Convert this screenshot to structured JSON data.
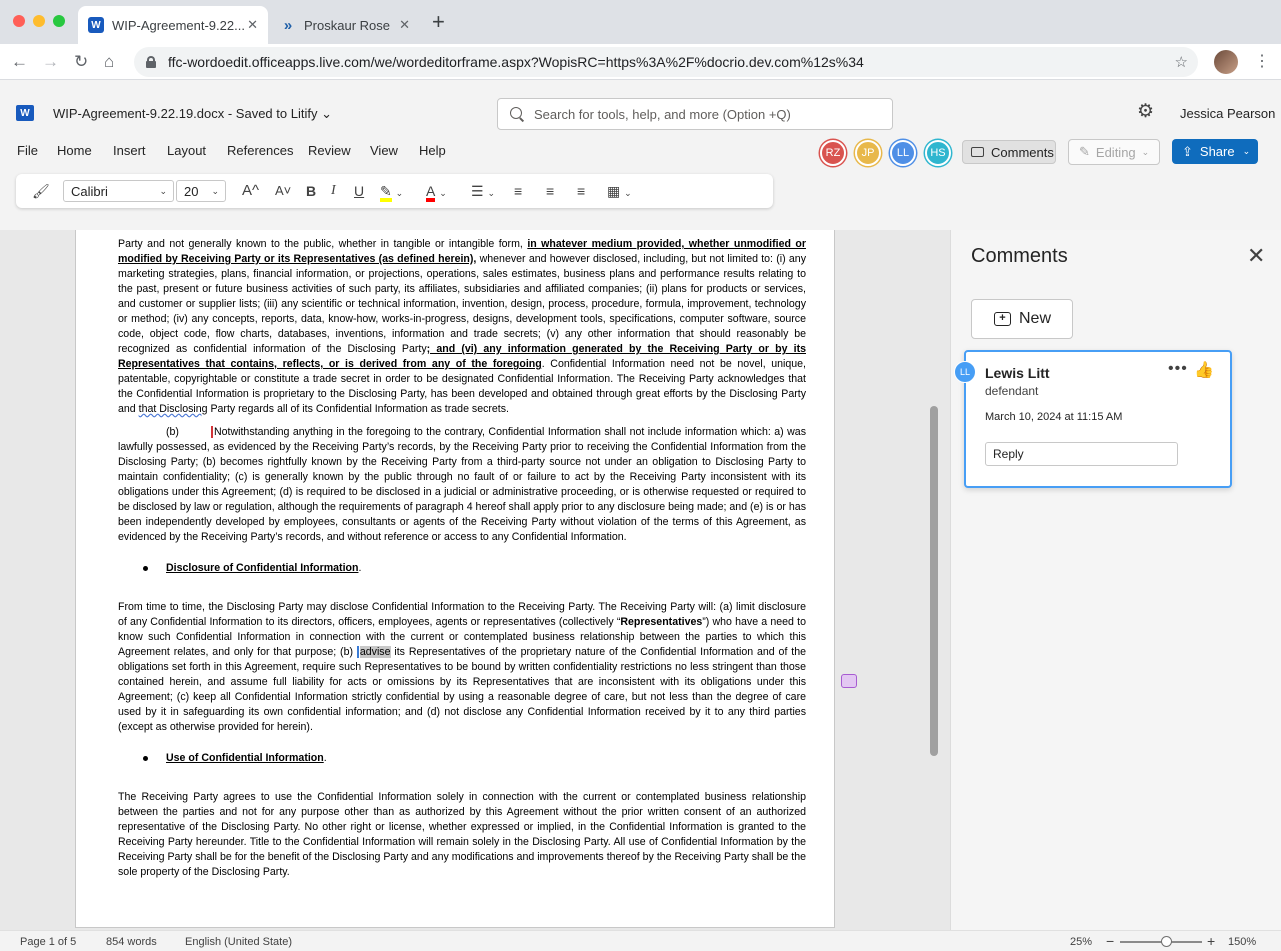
{
  "browser": {
    "tabs": [
      {
        "title": "WIP-Agreement-9.22...",
        "icon": "word-icon",
        "active": true
      },
      {
        "title": "Proskaur Rose",
        "icon": "chevron-logo-icon",
        "active": false
      }
    ],
    "url": "ffc-wordoedit.officeapps.live.com/we/wordeditorframe.aspx?WopisRC=https%3A%2F%docrio.dev.com%12s%34"
  },
  "word": {
    "doc_title": "WIP-Agreement-9.22.19.docx - Saved to Litify ⌄",
    "search_placeholder": "Search for tools, help, and more (Option +Q)",
    "user_name": "Jessica Pearson",
    "menu": [
      "File",
      "Home",
      "Insert",
      "Layout",
      "References",
      "Review",
      "View",
      "Help"
    ],
    "collaborators": [
      {
        "initials": "RZ",
        "color": "#d9534f"
      },
      {
        "initials": "JP",
        "color": "#e8b84a"
      },
      {
        "initials": "LL",
        "color": "#4f8fe6"
      },
      {
        "initials": "HS",
        "color": "#2fb6cf"
      }
    ],
    "comments_label": "Comments",
    "editing_label": "Editing",
    "share_label": "Share",
    "ribbon": {
      "font_name": "Calibri",
      "font_size": "20",
      "grow": "A^",
      "shrink": "A˅",
      "bold": "B",
      "italic": "I",
      "underline": "U",
      "highlight_color": "#ffff00",
      "font_color": "#ff0000"
    }
  },
  "document": {
    "para1_a": "Party and not generally known to the public, whether in tangible or intangible form, ",
    "para1_u1": "in whatever medium provided, whether unmodified or modified by Receiving Party or its Representatives (as defined herein),",
    "para1_b": " whenever and however disclosed, including, but not limited to: (i) any marketing strategies, plans, financial information, or projections, operations, sales estimates, business plans and performance results relating to the past, present or future business activities of such party, its affiliates, subsidiaries and affiliated companies; (ii) plans for products or services, and customer or supplier lists; (iii) any scientific or technical information, invention, design, process, procedure, formula, improvement, technology or method; (iv) any concepts, reports, data, know-how, works-in-progress, designs, development tools, specifications, computer software, source code, object code, flow charts, databases, inventions, information and trade secrets; (v) any other information that should reasonably be recognized as confidential information of the Disclosing Party",
    "para1_u2": "; and (vi) any information generated by the Receiving Party or by its Representatives that contains, reflects, or is derived from any of the foregoing",
    "para1_c": ".  Confidential Information need not be novel, unique, patentable, copyrightable or constitute a trade secret in order to be designated Confidential Information.  The Receiving Party acknowledges that the Confidential Information is proprietary to the Disclosing Party, has been developed and obtained through great efforts by the Disclosing Party and ",
    "para1_squiggle": "that Disclosing",
    "para1_d": " Party regards all of its Confidential Information as trade secrets.",
    "para2_label": "(b)",
    "para2": "Notwithstanding anything in the foregoing to the contrary, Confidential Information shall not include information which: a) was lawfully possessed, as evidenced by the Receiving Party’s records, by the Receiving Party prior to receiving the Confidential Information from the Disclosing Party; (b) becomes rightfully known by the Receiving Party from a third-party source not under an obligation to Disclosing Party to maintain confidentiality; (c) is generally known by the public through no fault of or failure to act by the Receiving Party inconsistent with its obligations under this Agreement; (d) is required to be disclosed in a judicial or administrative proceeding, or is otherwise requested or required to be disclosed by law or regulation, although the requirements of paragraph 4 hereof shall apply prior to any disclosure being made; and (e) is or has been independently developed by employees, consultants or agents of the Receiving Party without violation of the terms of this Agreement, as evidenced by the Receiving Party’s records, and without reference or access to any Confidential Information.",
    "heading1": "Disclosure of Confidential Information",
    "heading_period": ".",
    "para3_a": "From time to time, the Disclosing Party may disclose Confidential Information to the Receiving Party.  The Receiving Party will:  (a) limit disclosure of any Confidential Information to its directors, officers, employees, agents or representatives (collectively “",
    "para3_bold": "Representatives",
    "para3_b": "”) who have a need to know such Confidential Information in connection with the current or contemplated business relationship between the parties to which this Agreement relates, and only for that purpose;  (b) ",
    "para3_hl": "advise",
    "para3_c": " its Representatives of the proprietary nature of the Confidential Information and of the obligations set forth in this Agreement, require such Representatives to be bound by written confidentiality restrictions no less stringent than those contained herein, and assume full liability for acts or omissions by its Representatives that are inconsistent with its obligations under this Agreement; (c) keep all Confidential Information strictly confidential by using a reasonable degree of care, but not less than the degree of care used by it in safeguarding its own confidential information; and (d) not disclose any Confidential Information received by it to any third parties (except as otherwise provided for herein).",
    "heading2": "Use of Confidential Information",
    "para4": "The Receiving Party agrees to use the Confidential Information solely in connection with the current or contemplated business relationship between the parties and not for any purpose other than as authorized by this Agreement without the prior written consent of an authorized representative of the Disclosing Party.  No other right or license, whether expressed or implied, in the Confidential Information is granted to the Receiving Party hereunder.  Title to the Confidential Information will remain solely in the Disclosing Party.  All use of Confidential Information by the Receiving Party shall be for the benefit of the Disclosing Party and any modifications and improvements thereof by the Receiving Party shall be the sole property of the Disclosing Party."
  },
  "comments_pane": {
    "title": "Comments",
    "new_label": "New",
    "comment": {
      "initials": "LL",
      "author": "Lewis Litt",
      "text": "defendant",
      "date": "March 10, 2024 at 11:15 AM",
      "reply_placeholder": "Reply"
    }
  },
  "status": {
    "page": "Page 1 of 5",
    "words": "854 words",
    "language": "English (United State)",
    "zoom_left": "25%",
    "zoom_right": "150%"
  }
}
